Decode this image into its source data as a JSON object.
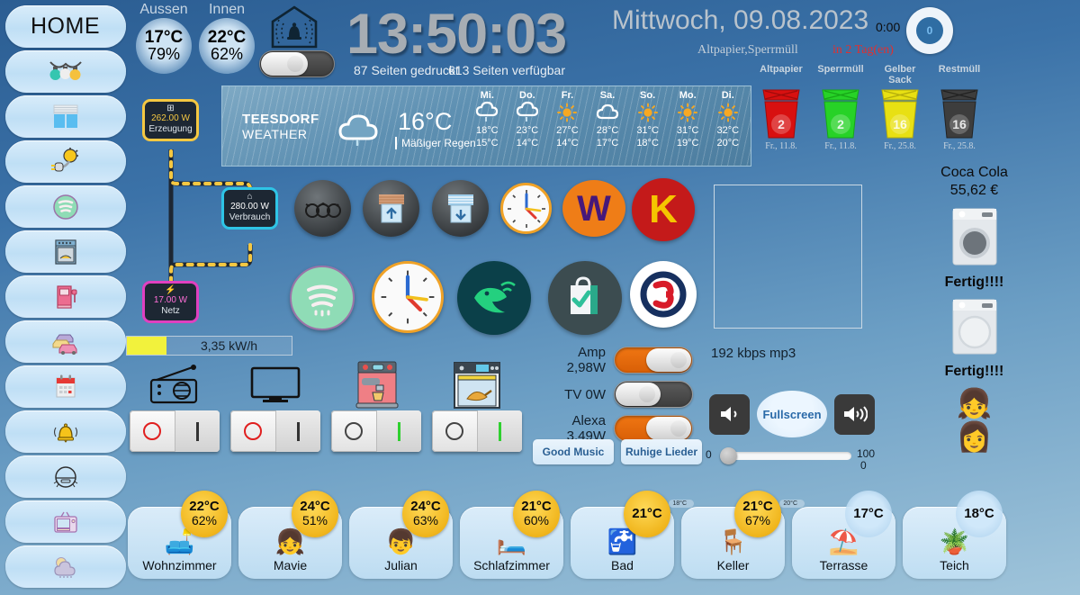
{
  "sidebar": {
    "home_label": "HOME",
    "items": [
      {
        "name": "lights",
        "icon": "string-lights-icon"
      },
      {
        "name": "blinds",
        "icon": "window-blinds-icon"
      },
      {
        "name": "solar",
        "icon": "solar-plug-icon"
      },
      {
        "name": "spotify",
        "icon": "spotify-icon"
      },
      {
        "name": "oven",
        "icon": "oven-icon"
      },
      {
        "name": "fuel",
        "icon": "fuel-pump-icon"
      },
      {
        "name": "traffic",
        "icon": "cars-icon"
      },
      {
        "name": "calendar",
        "icon": "calendar-icon"
      },
      {
        "name": "alarm",
        "icon": "bell-icon"
      },
      {
        "name": "vacuum",
        "icon": "robot-vacuum-icon"
      },
      {
        "name": "tv",
        "icon": "retro-tv-icon"
      },
      {
        "name": "weather",
        "icon": "sun-cloud-icon"
      }
    ]
  },
  "topbar": {
    "outside_label": "Aussen",
    "outside_temp": "17°C",
    "outside_hum": "79%",
    "inside_label": "Innen",
    "inside_temp": "22°C",
    "inside_hum": "62%",
    "alarm_icon": "alarm-house-bell-icon",
    "clock": "13:50:03",
    "printed_pages": "87 Seiten gedruckt",
    "available_pages": "613 Seiten verfügbar",
    "date": "Mittwoch, 09.08.2023",
    "waste_note": "Altpapier,Sperrmüll",
    "waste_days": "in 2 Tag(en)",
    "ring_time": "0:00",
    "ring_value": "0"
  },
  "bins": [
    {
      "label": "Altpapier",
      "count": "2",
      "date": "Fr., 11.8.",
      "color": "#d81010",
      "dark": "#a00b0b"
    },
    {
      "label": "Sperrmüll",
      "count": "2",
      "date": "Fr., 11.8.",
      "color": "#27d227",
      "dark": "#17a617"
    },
    {
      "label": "Gelber Sack",
      "count": "16",
      "date": "Fr., 25.8.",
      "color": "#e8e013",
      "dark": "#b5ae0c"
    },
    {
      "label": "Restmüll",
      "count": "16",
      "date": "Fr., 25.8.",
      "color": "#3d3d3d",
      "dark": "#222222"
    }
  ],
  "weather": {
    "city_line1": "TEESDORF",
    "city_line2": "WEATHER",
    "current_icon": "cloud-rain-icon",
    "current_temp": "16°C",
    "current_desc": "Mäßiger Regen",
    "forecast": [
      {
        "day": "Mi.",
        "icon": "cloud-rain-icon",
        "high": "18°C",
        "low": "15°C"
      },
      {
        "day": "Do.",
        "icon": "cloud-rain-icon",
        "high": "23°C",
        "low": "14°C"
      },
      {
        "day": "Fr.",
        "icon": "sun-icon",
        "high": "27°C",
        "low": "14°C"
      },
      {
        "day": "Sa.",
        "icon": "cloud-icon",
        "high": "28°C",
        "low": "17°C"
      },
      {
        "day": "So.",
        "icon": "sun-icon",
        "high": "31°C",
        "low": "18°C"
      },
      {
        "day": "Mo.",
        "icon": "sun-icon",
        "high": "31°C",
        "low": "19°C"
      },
      {
        "day": "Di.",
        "icon": "sun-icon",
        "high": "32°C",
        "low": "20°C"
      }
    ]
  },
  "energy": {
    "production": {
      "value": "262.00 W",
      "label": "Erzeugung",
      "color": "#f5c842"
    },
    "consumption": {
      "value": "280.00 W",
      "label": "Verbrauch",
      "color": "#2ec4e6"
    },
    "grid": {
      "value": "17.00 W",
      "label": "Netz",
      "color": "#e040c0"
    },
    "kwh_text": "3,35 kW/h"
  },
  "apps": {
    "row1": [
      {
        "name": "glasses-icon"
      },
      {
        "name": "blinds-up-icon"
      },
      {
        "name": "blinds-down-icon"
      },
      {
        "name": "clock-icon"
      },
      {
        "name": "wien-w-icon"
      },
      {
        "name": "k-icon"
      }
    ],
    "row2": [
      {
        "name": "spotify-icon"
      },
      {
        "name": "clock-icon"
      },
      {
        "name": "kiwi-bird-icon"
      },
      {
        "name": "shopping-bag-icon"
      },
      {
        "name": "oe3-icon"
      }
    ]
  },
  "devices": [
    {
      "label": "radio",
      "icon": "radio-icon",
      "state": "off"
    },
    {
      "label": "tv",
      "icon": "monitor-icon",
      "state": "off"
    },
    {
      "label": "coffee",
      "icon": "coffee-machine-icon",
      "state": "on"
    },
    {
      "label": "oven",
      "icon": "oven-icon",
      "state": "on"
    }
  ],
  "media": {
    "switches": [
      {
        "label": "Amp 2,98W",
        "state": "on"
      },
      {
        "label": "TV 0W",
        "state": "off"
      },
      {
        "label": "Alexa 3,49W",
        "state": "on"
      }
    ],
    "preset1": "Good Music",
    "preset2": "Ruhige Lieder",
    "bitrate": "192 kbps mp3",
    "fullscreen": "Fullscreen",
    "vol_min": "0",
    "vol_max": "100",
    "vol_value": "0"
  },
  "right": {
    "coca_label": "Coca Cola",
    "coca_price": "55,62 €",
    "washer_status": "Fertig!!!!",
    "dryer_status": "Fertig!!!!",
    "face1": "person-teal-bow-icon",
    "face2": "person-ponytail-icon"
  },
  "rooms": [
    {
      "name": "Wohnzimmer",
      "emoji": "🛋️",
      "temp": "22°C",
      "hum": "62%",
      "badge": "gold",
      "mini": ""
    },
    {
      "name": "Mavie",
      "emoji": "👧",
      "temp": "24°C",
      "hum": "51%",
      "badge": "gold",
      "mini": ""
    },
    {
      "name": "Julian",
      "emoji": "👦",
      "temp": "24°C",
      "hum": "63%",
      "badge": "gold",
      "mini": ""
    },
    {
      "name": "Schlafzimmer",
      "emoji": "🛏️",
      "temp": "21°C",
      "hum": "60%",
      "badge": "gold",
      "mini": ""
    },
    {
      "name": "Bad",
      "emoji": "🚰",
      "temp": "21°C",
      "hum": "",
      "badge": "gold",
      "mini": "18°C"
    },
    {
      "name": "Keller",
      "emoji": "🪑",
      "temp": "21°C",
      "hum": "67%",
      "badge": "gold",
      "mini": "20°C"
    },
    {
      "name": "Terrasse",
      "emoji": "⛱️",
      "temp": "17°C",
      "hum": "",
      "badge": "plain",
      "mini": ""
    },
    {
      "name": "Teich",
      "emoji": "🪴",
      "temp": "18°C",
      "hum": "",
      "badge": "plain",
      "mini": ""
    }
  ]
}
